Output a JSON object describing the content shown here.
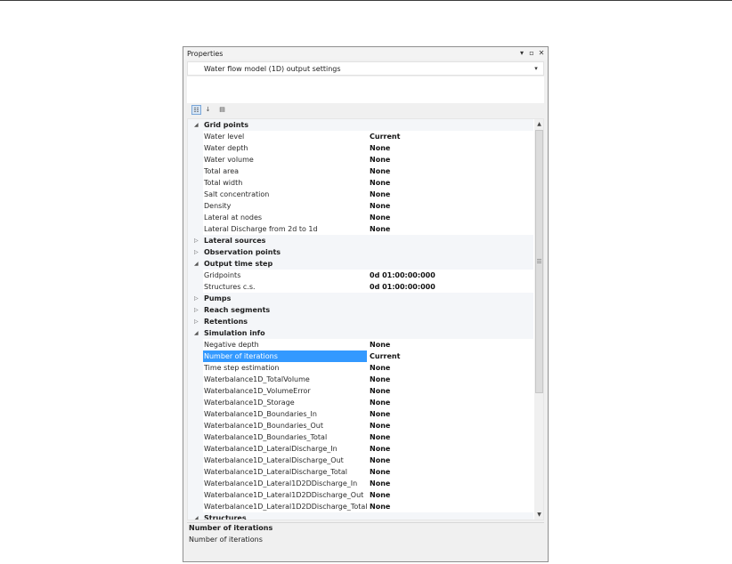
{
  "panel": {
    "title": "Properties",
    "controls": {
      "pin": "▾",
      "maximize": "▫",
      "close": "✕"
    }
  },
  "selector": {
    "value": "Water flow model (1D) output settings",
    "arrow": "▾"
  },
  "toolbar": {
    "icons": [
      "categorized-view-icon",
      "alphabetical-sort-icon",
      "property-pages-icon"
    ],
    "glyphs": {
      "categorized": "☷",
      "alphabetical": "↓",
      "pages": "▤"
    }
  },
  "grid": {
    "rows": [
      {
        "type": "cat",
        "expanded": true,
        "label": "Grid points"
      },
      {
        "type": "prop",
        "name": "Water level",
        "value": "Current"
      },
      {
        "type": "prop",
        "name": "Water depth",
        "value": "None"
      },
      {
        "type": "prop",
        "name": "Water volume",
        "value": "None"
      },
      {
        "type": "prop",
        "name": "Total area",
        "value": "None"
      },
      {
        "type": "prop",
        "name": "Total width",
        "value": "None"
      },
      {
        "type": "prop",
        "name": "Salt concentration",
        "value": "None"
      },
      {
        "type": "prop",
        "name": "Density",
        "value": "None"
      },
      {
        "type": "prop",
        "name": "Lateral at nodes",
        "value": "None"
      },
      {
        "type": "prop",
        "name": "Lateral Discharge from 2d to 1d",
        "value": "None"
      },
      {
        "type": "cat",
        "expanded": false,
        "label": "Lateral sources"
      },
      {
        "type": "cat",
        "expanded": false,
        "label": "Observation points"
      },
      {
        "type": "cat",
        "expanded": true,
        "label": "Output time step"
      },
      {
        "type": "prop",
        "name": "Gridpoints",
        "value": "0d 01:00:00:000"
      },
      {
        "type": "prop",
        "name": "Structures c.s.",
        "value": "0d 01:00:00:000"
      },
      {
        "type": "cat",
        "expanded": false,
        "label": "Pumps"
      },
      {
        "type": "cat",
        "expanded": false,
        "label": "Reach segments"
      },
      {
        "type": "cat",
        "expanded": false,
        "label": "Retentions"
      },
      {
        "type": "cat",
        "expanded": true,
        "label": "Simulation info"
      },
      {
        "type": "prop",
        "name": "Negative depth",
        "value": "None"
      },
      {
        "type": "prop",
        "name": "Number of iterations",
        "value": "Current",
        "selected": true
      },
      {
        "type": "prop",
        "name": "Time step estimation",
        "value": "None"
      },
      {
        "type": "prop",
        "name": "Waterbalance1D_TotalVolume",
        "value": "None"
      },
      {
        "type": "prop",
        "name": "Waterbalance1D_VolumeError",
        "value": "None"
      },
      {
        "type": "prop",
        "name": "Waterbalance1D_Storage",
        "value": "None"
      },
      {
        "type": "prop",
        "name": "Waterbalance1D_Boundaries_In",
        "value": "None"
      },
      {
        "type": "prop",
        "name": "Waterbalance1D_Boundaries_Out",
        "value": "None"
      },
      {
        "type": "prop",
        "name": "Waterbalance1D_Boundaries_Total",
        "value": "None"
      },
      {
        "type": "prop",
        "name": "Waterbalance1D_LateralDischarge_In",
        "value": "None"
      },
      {
        "type": "prop",
        "name": "Waterbalance1D_LateralDischarge_Out",
        "value": "None"
      },
      {
        "type": "prop",
        "name": "Waterbalance1D_LateralDischarge_Total",
        "value": "None"
      },
      {
        "type": "prop",
        "name": "Waterbalance1D_Lateral1D2DDischarge_In",
        "value": "None"
      },
      {
        "type": "prop",
        "name": "Waterbalance1D_Lateral1D2DDischarge_Out",
        "value": "None"
      },
      {
        "type": "prop",
        "name": "Waterbalance1D_Lateral1D2DDischarge_Total",
        "value": "None"
      },
      {
        "type": "cat",
        "expanded": true,
        "label": "Structures"
      }
    ],
    "glyphs": {
      "expanded": "◢",
      "collapsed": "▷"
    }
  },
  "scrollbar": {
    "up": "▲",
    "down": "▼"
  },
  "help": {
    "title": "Number of iterations",
    "description": "Number of iterations"
  }
}
